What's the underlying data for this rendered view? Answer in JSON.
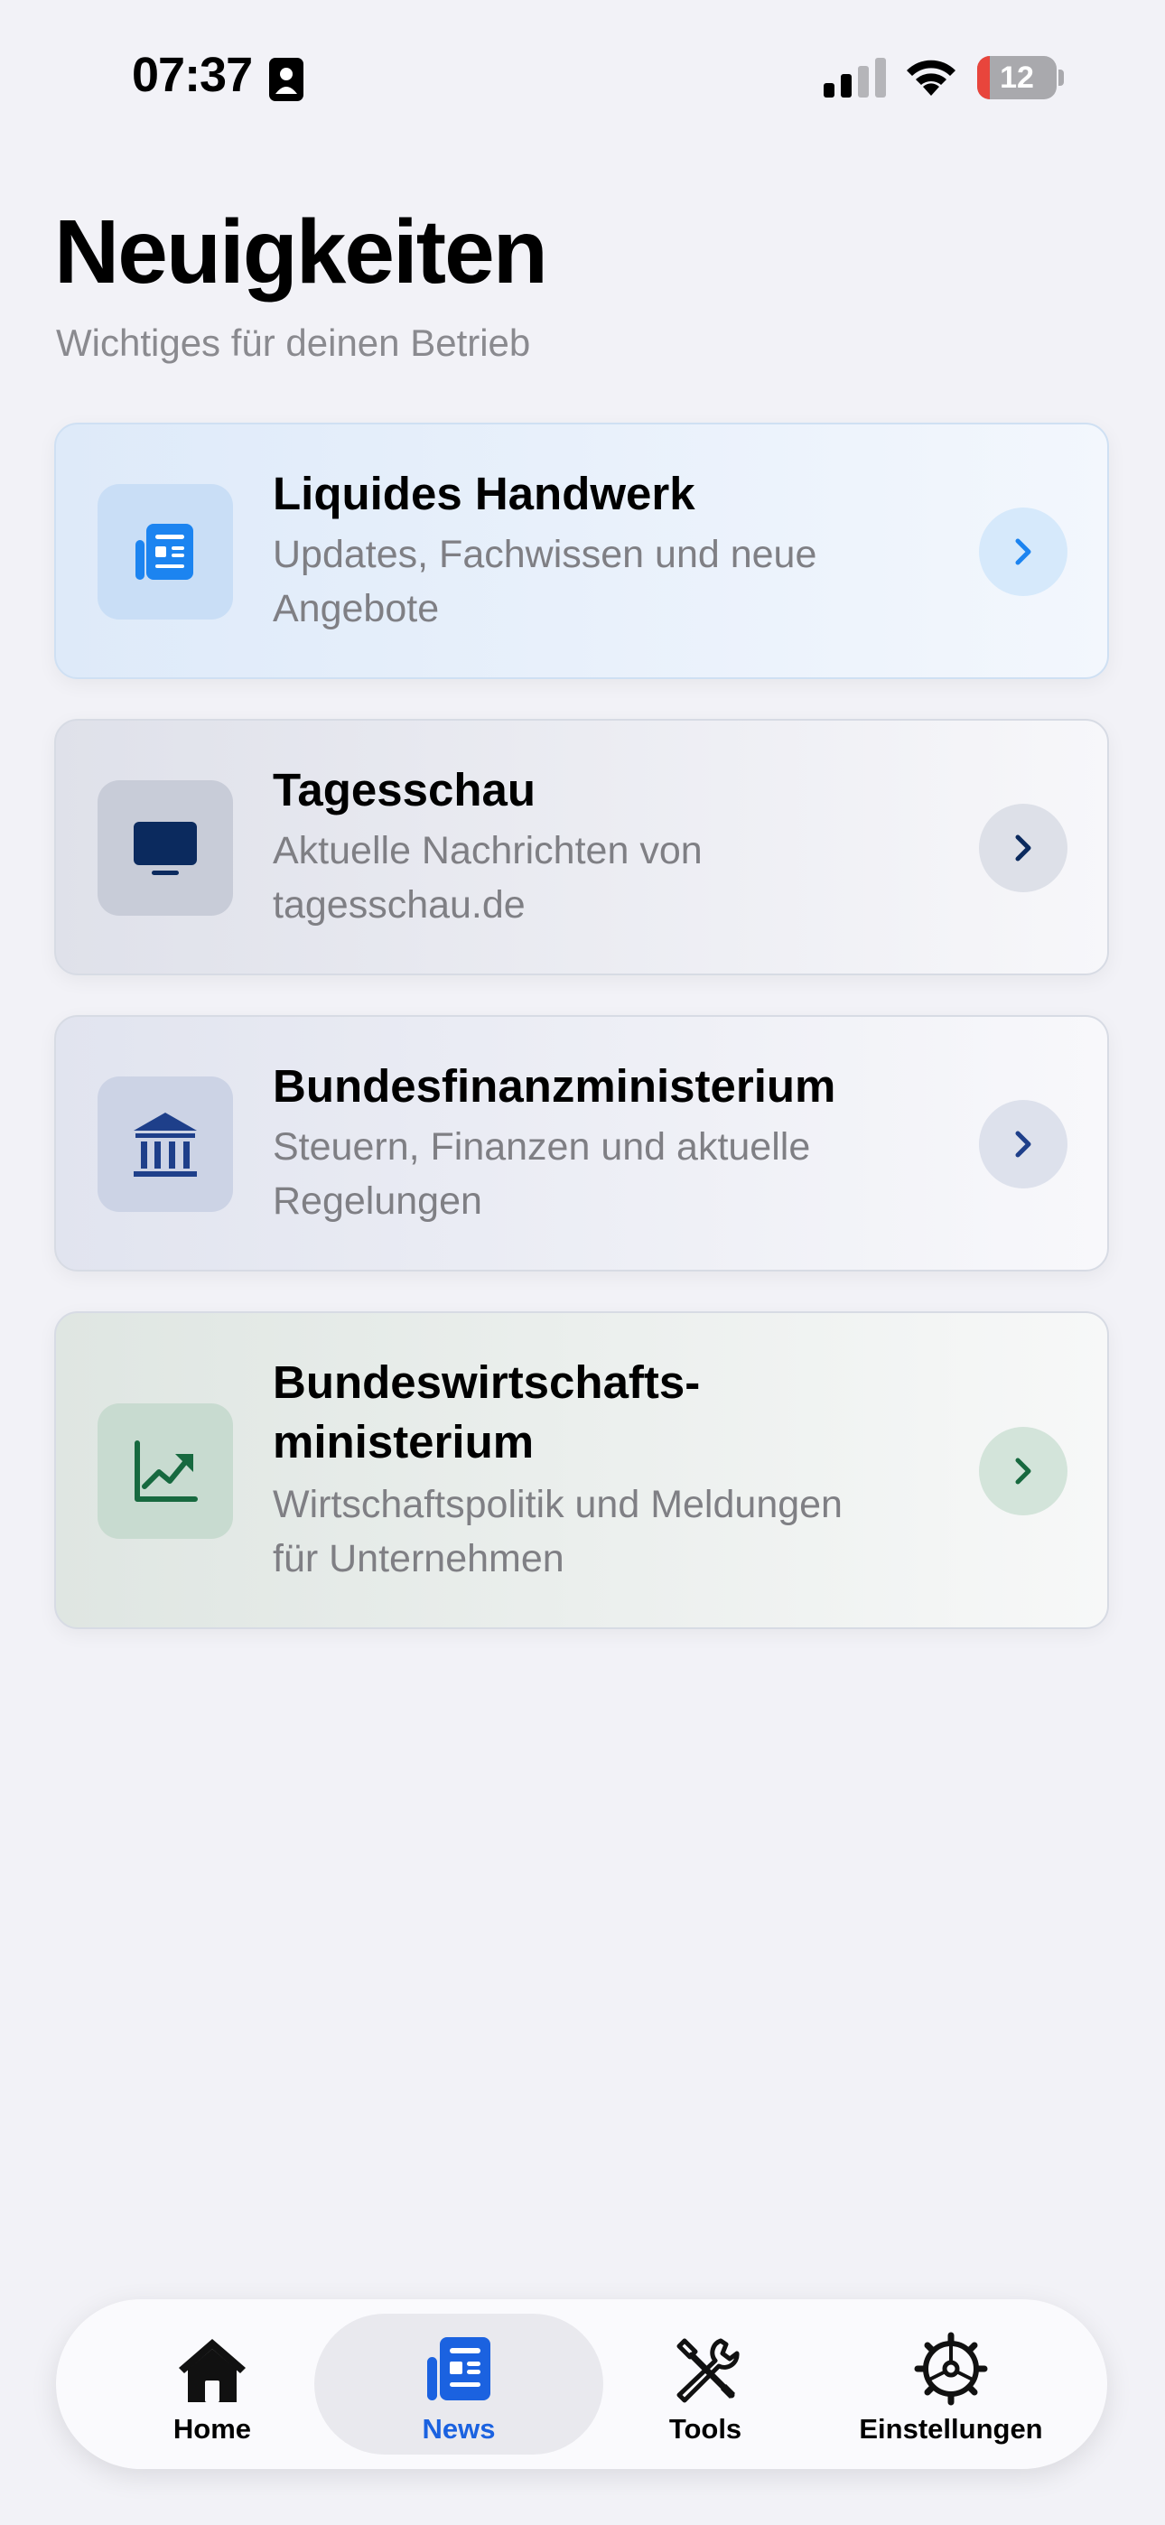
{
  "status_bar": {
    "time": "07:37",
    "battery_level": "12",
    "battery_color": "#e8453c"
  },
  "header": {
    "title": "Neuigkeiten",
    "subtitle": "Wichtiges für deinen Betrieb"
  },
  "feeds": [
    {
      "title": "Liquides Handwerk",
      "description": "Updates, Fachwissen und neue Angebote",
      "icon": "newspaper-icon",
      "accent": "#1c84f0"
    },
    {
      "title": "Tagesschau",
      "description": "Aktuelle Nachrichten von tagesschau.de",
      "icon": "tv-icon",
      "accent": "#0b2a5e"
    },
    {
      "title": "Bundesfinanzministerium",
      "description": "Steuern, Finanzen und aktuelle Regelungen",
      "icon": "bank-icon",
      "accent": "#1e3f8a"
    },
    {
      "title": "Bundeswirtschafts-ministerium",
      "description": "Wirtschaftspolitik und Meldungen für Unternehmen",
      "icon": "chart-trend-icon",
      "accent": "#17693f"
    }
  ],
  "tab_bar": {
    "active": "News",
    "active_color": "#1b62e0",
    "tabs": [
      {
        "label": "Home",
        "icon": "house-icon"
      },
      {
        "label": "News",
        "icon": "newspaper-icon"
      },
      {
        "label": "Tools",
        "icon": "tools-icon"
      },
      {
        "label": "Einstellungen",
        "icon": "gear-icon"
      }
    ]
  }
}
